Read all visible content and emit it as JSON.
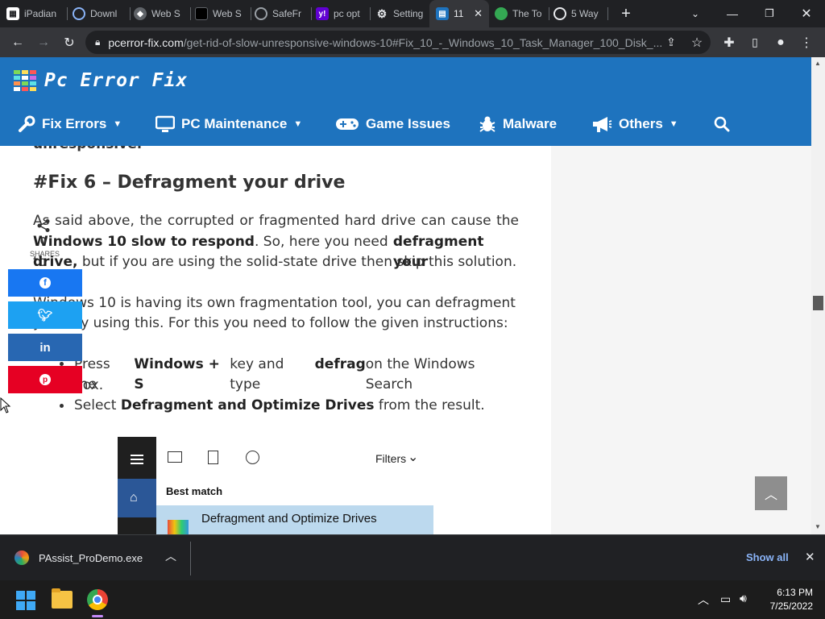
{
  "tabs": [
    {
      "title": "iPadian",
      "icon": "ipadian-favicon",
      "color": "#ffffff"
    },
    {
      "title": "Downl",
      "icon": "globe-favicon",
      "color": "#8ab4f8"
    },
    {
      "title": "Web S",
      "icon": "web-favicon",
      "color": "#8ab4f8"
    },
    {
      "title": "Web S",
      "icon": "black-favicon",
      "color": "#000000"
    },
    {
      "title": "SafeFr",
      "icon": "globe-favicon",
      "color": "#9aa0a6"
    },
    {
      "title": "pc opt",
      "icon": "yahoo-favicon",
      "color": "#6001d2"
    },
    {
      "title": "Setting",
      "icon": "gear-favicon",
      "color": "#e8eaed"
    },
    {
      "title": "11",
      "icon": "pcerror-favicon",
      "color": "#1e73be"
    },
    {
      "title": "The To",
      "icon": "globe-color-favicon",
      "color": "#34a853"
    },
    {
      "title": "5 Way",
      "icon": "clock-favicon",
      "color": "#e8eaed"
    }
  ],
  "address": {
    "domain": "pcerror-fix.com",
    "path": "/get-rid-of-slow-unresponsive-windows-10#Fix_10_-_Windows_10_Task_Manager_100_Disk_..."
  },
  "site": {
    "logo_text": "Pc Error Fix",
    "nav": [
      {
        "label": "Fix Errors",
        "icon": "wrench-icon",
        "has_dropdown": true
      },
      {
        "label": "PC Maintenance",
        "icon": "monitor-icon",
        "has_dropdown": true
      },
      {
        "label": "Game Issues",
        "icon": "gamepad-icon",
        "has_dropdown": false
      },
      {
        "label": "Malware",
        "icon": "bug-icon",
        "has_dropdown": false
      },
      {
        "label": "Others",
        "icon": "megaphone-icon",
        "has_dropdown": true
      }
    ]
  },
  "article": {
    "cut_text": "unresponsive.",
    "heading": "#Fix 6 – Defragment your drive",
    "p1_a": "As said above, the corrupted or fragmented hard drive can cause the",
    "p1_b_bold": "Windows 10 slow to respond",
    "p1_c": ". So, here you need to",
    "p1_d_bold": "defragment your",
    "p1_e_bold": "drive,",
    "p1_f": " but if you are using the solid-state drive then skip this solution.",
    "p2_a": "Windows 10 is having its own fragmentation tool, you can defragment your",
    "p2_b": "drive by using this. For this you need to follow the given instructions:",
    "li1_a": "Press the",
    "li1_b": "Windows + S",
    "li1_c": "key and type",
    "li1_d": "defrag",
    "li1_e": "on the Windows Search",
    "li1_f": "box.",
    "li2_a": "Select",
    "li2_b": "Defragment and Optimize Drives",
    "li2_c": "from the result."
  },
  "share": {
    "count": "0",
    "label": "SHARES",
    "buttons": [
      {
        "name": "facebook",
        "color": "#1877f2",
        "glyph": "f"
      },
      {
        "name": "twitter",
        "color": "#1da1f2",
        "glyph": "t"
      },
      {
        "name": "linkedin",
        "color": "#2867b2",
        "glyph": "in"
      },
      {
        "name": "pinterest",
        "color": "#e60023",
        "glyph": "p"
      }
    ]
  },
  "embedded": {
    "filters": "Filters",
    "best_match": "Best match",
    "result": "Defragment and Optimize Drives"
  },
  "downloads": {
    "file": "PAssist_ProDemo.exe",
    "show_all": "Show all"
  },
  "taskbar": {
    "time": "6:13 PM",
    "date": "7/25/2022"
  }
}
